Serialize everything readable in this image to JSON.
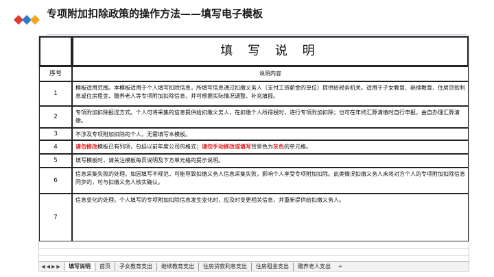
{
  "slide": {
    "title": "专项附加扣除政策的操作方法——填写电子模板"
  },
  "sheet": {
    "main_title": "填 写 说 明",
    "header_no": "序号",
    "header_desc": "说明内容",
    "rows": [
      {
        "no": "1",
        "text": "模板适用范围。本模板适用于个人填写扣除信息，所填写信息通过扣缴义务人（支付工资薪金的单位）提供给税务机关。适用于子女教育、继续教育、住房贷款利息或住房租金、赡养老人等专项附加扣除信息，并可根据实际情况调整、补充填报。"
      },
      {
        "no": "2",
        "text": "专项附加扣除报送方式。个人可将采集的信息提供给扣缴义务人，在扣缴个人所得税时，进行专项附加扣除；也可在年终汇算清缴时自行申报，由自办理汇算清缴。"
      },
      {
        "no": "3",
        "text": "不涉及专项附加扣除的个人，无需填写本模板。"
      },
      {
        "no": "4",
        "pre": "请勿修改",
        "mid": "模板已有列项，包括以前年度公司的格式；",
        "bold": "请勿手动修改或填写",
        "post": "背景色为",
        "gray": "灰色",
        "tail": "的单元格。"
      },
      {
        "no": "5",
        "text": "填写模板时，请关注模板每页说明及下方单元格的提示说明。"
      },
      {
        "no": "6",
        "text": "信息采集失败的处理。如因填写不规范，可能导致扣缴义务人信息采集失败，影响个人享受专项附加扣除。此类情况扣缴义务人未将对方个人的专项附加扣除信息同步的，可与扣缴义务人核实确认。"
      },
      {
        "no": "7",
        "text": "信息变化的处理。个人填写的专项附加扣除信息发生变化时，应及时变更相关信息，并重新提供给扣缴义务人。"
      }
    ],
    "tabs": [
      "填写说明",
      "首页",
      "子女教育支出",
      "继续教育支出",
      "住房贷款利息支出",
      "住房租金支出",
      "赡养老人支出"
    ]
  },
  "icons": {
    "logo": "diamond-logo-icon",
    "tab_add": "plus-icon"
  },
  "colors": {
    "logo_red": "#e23b30",
    "logo_blue": "#2f79c9",
    "logo_orange": "#f3a51c",
    "warning_red": "#e01818"
  }
}
